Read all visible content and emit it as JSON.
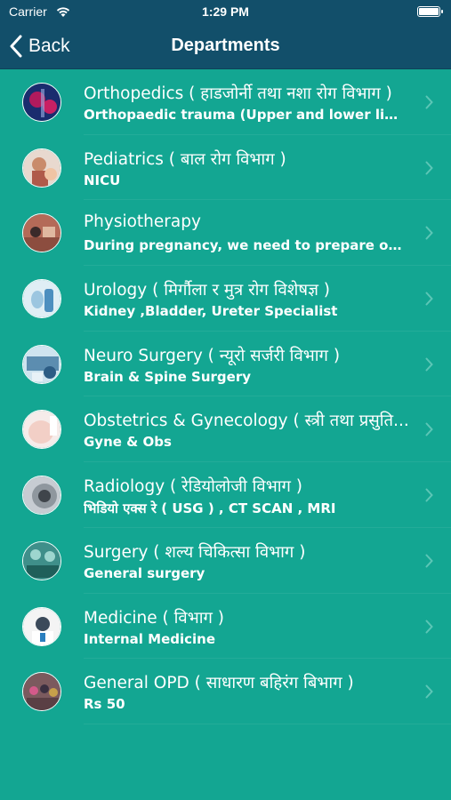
{
  "status": {
    "carrier": "Carrier",
    "time": "1:29 PM"
  },
  "nav": {
    "back_label": "Back",
    "title": "Departments"
  },
  "departments": [
    {
      "title": "Orthopedics ( हाडजोर्नी तथा नशा रोग विभाग )",
      "subtitle": "Orthopaedic trauma (Upper and lower limb...",
      "icon": "orthopedics-thumbnail"
    },
    {
      "title": "Pediatrics ( बाल रोग विभाग )",
      "subtitle": "NICU",
      "icon": "pediatrics-thumbnail"
    },
    {
      "title": "Physiotherapy",
      "subtitle": "During pregnancy, we need to prepare our...",
      "icon": "physiotherapy-thumbnail"
    },
    {
      "title": "Urology ( मिर्गौला र मुत्र रोग विशेषज्ञ )",
      "subtitle": "Kidney ,Bladder, Ureter Specialist",
      "icon": "urology-thumbnail"
    },
    {
      "title": "Neuro Surgery ( न्यूरो सर्जरी विभाग )",
      "subtitle": "Brain & Spine Surgery",
      "icon": "neuro-surgery-thumbnail"
    },
    {
      "title": "Obstetrics & Gynecology ( स्त्री तथा प्रसुति...",
      "subtitle": "Gyne & Obs",
      "icon": "obstetrics-thumbnail"
    },
    {
      "title": "Radiology ( रेडियोलोजी विभाग )",
      "subtitle": "भिडियो एक्स रे ( USG ) , CT SCAN , MRI",
      "icon": "radiology-thumbnail"
    },
    {
      "title": "Surgery ( शल्य चिकित्सा विभाग )",
      "subtitle": "General surgery",
      "icon": "surgery-thumbnail"
    },
    {
      "title": "Medicine ( विभाग )",
      "subtitle": "Internal Medicine",
      "icon": "medicine-thumbnail"
    },
    {
      "title": "General OPD ( साधारण बहिरंग बिभाग )",
      "subtitle": "Rs 50",
      "icon": "general-opd-thumbnail"
    }
  ],
  "colors": {
    "background": "#13a692",
    "navbar": "#124f6a",
    "text": "#ffffff",
    "chevron": "#5cc6b6"
  }
}
